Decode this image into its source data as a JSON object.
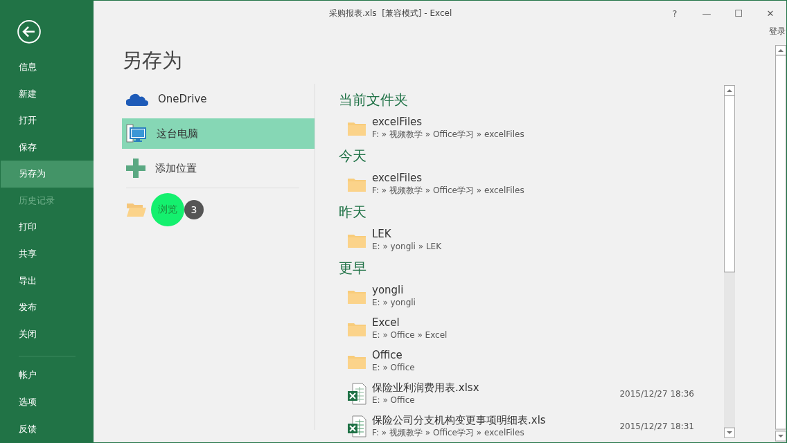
{
  "window": {
    "title": "采购报表.xls  [兼容模式] - Excel",
    "controls": [
      "?",
      "—",
      "☐",
      "✕"
    ],
    "sign_in": "登录"
  },
  "sidebar": {
    "items": [
      {
        "label": "信息",
        "selected": false,
        "disabled": false
      },
      {
        "label": "新建",
        "selected": false,
        "disabled": false
      },
      {
        "label": "打开",
        "selected": false,
        "disabled": false
      },
      {
        "label": "保存",
        "selected": false,
        "disabled": false
      },
      {
        "label": "另存为",
        "selected": true,
        "disabled": false
      },
      {
        "label": "历史记录",
        "selected": false,
        "disabled": true
      },
      {
        "label": "打印",
        "selected": false,
        "disabled": false
      },
      {
        "label": "共享",
        "selected": false,
        "disabled": false
      },
      {
        "label": "导出",
        "selected": false,
        "disabled": false
      },
      {
        "label": "发布",
        "selected": false,
        "disabled": false
      },
      {
        "label": "关闭",
        "selected": false,
        "disabled": false
      }
    ],
    "bottom_items": [
      {
        "label": "帐户",
        "selected": false,
        "disabled": false
      },
      {
        "label": "选项",
        "selected": false,
        "disabled": false
      },
      {
        "label": "反馈",
        "selected": false,
        "disabled": false
      }
    ]
  },
  "heading": "另存为",
  "places": [
    {
      "label": "OneDrive",
      "kind": "cloud",
      "selected": false
    },
    {
      "label": "这台电脑",
      "kind": "computer",
      "selected": true
    },
    {
      "label": "添加位置",
      "kind": "add",
      "selected": false
    }
  ],
  "browse": {
    "label": "浏览",
    "highlighted": true,
    "step_badge": "3"
  },
  "recent": [
    {
      "header": "当前文件夹",
      "items": [
        {
          "kind": "folder",
          "name": "excelFiles",
          "path": "F: » 视频教学 » Office学习 » excelFiles"
        }
      ]
    },
    {
      "header": "今天",
      "items": [
        {
          "kind": "folder",
          "name": "excelFiles",
          "path": "F: » 视频教学 » Office学习 » excelFiles"
        }
      ]
    },
    {
      "header": "昨天",
      "items": [
        {
          "kind": "folder",
          "name": "LEK",
          "path": "E: » yongli » LEK"
        }
      ]
    },
    {
      "header": "更早",
      "items": [
        {
          "kind": "folder",
          "name": "yongli",
          "path": "E: » yongli"
        },
        {
          "kind": "folder",
          "name": "Excel",
          "path": "E: » Office » Excel"
        },
        {
          "kind": "folder",
          "name": "Office",
          "path": "E: » Office"
        },
        {
          "kind": "workbook",
          "name": "保险业利润费用表.xlsx",
          "path": "E: » Office",
          "date": "2015/12/27 18:36"
        },
        {
          "kind": "legacy_workbook",
          "name": "保险公司分支机构变更事项明细表.xls",
          "path": "F: » 视频教学 » Office学习 » excelFiles",
          "date": "2015/12/27 18:31"
        }
      ]
    }
  ]
}
